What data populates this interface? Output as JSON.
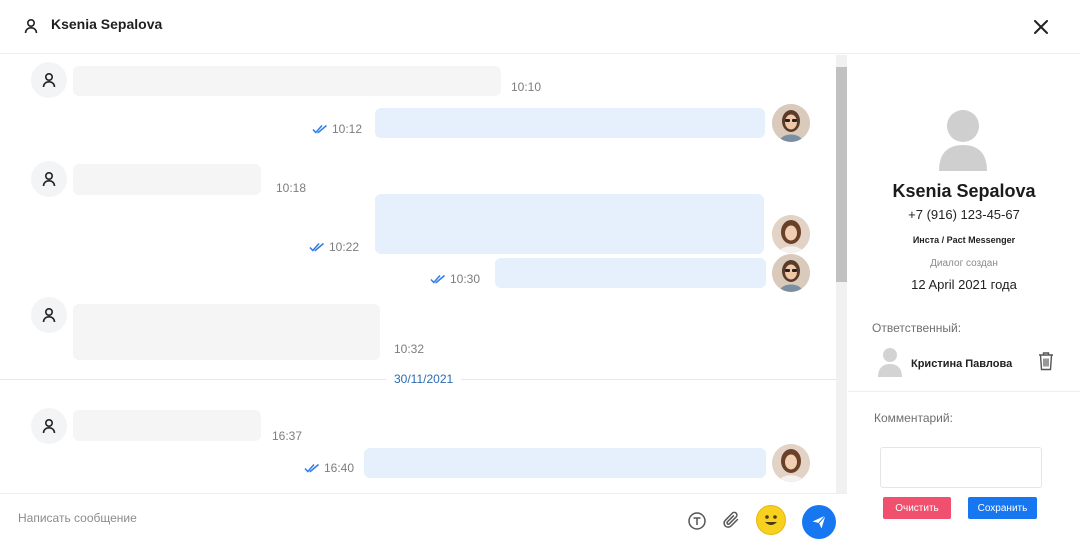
{
  "header": {
    "title": "Ksenia Sepalova"
  },
  "messages": [
    {
      "direction": "in",
      "time": "10:10"
    },
    {
      "direction": "out",
      "time": "10:12",
      "status": "read"
    },
    {
      "direction": "in",
      "time": "10:18"
    },
    {
      "direction": "out",
      "time": "10:22",
      "status": "read"
    },
    {
      "direction": "out",
      "time": "10:30",
      "status": "read"
    },
    {
      "direction": "in",
      "time": "10:32"
    },
    {
      "direction": "in",
      "time": "16:37"
    },
    {
      "direction": "out",
      "time": "16:40",
      "status": "read"
    }
  ],
  "date_separator": "30/11/2021",
  "composer": {
    "placeholder": "Написать сообщение"
  },
  "sidebar": {
    "name": "Ksenia Sepalova",
    "phone": "+7 (916) 123-45-67",
    "source": "Инста / Pact Messenger",
    "created_label": "Диалог создан",
    "created_date": "12 April 2021 года",
    "responsible_label": "Ответственный:",
    "responsible_name": "Кристина Павлова",
    "comment_label": "Комментарий:",
    "clear_label": "Очистить",
    "save_label": "Сохранить"
  },
  "colors": {
    "accent": "#1677f0",
    "danger": "#f0506e",
    "outgoing_bubble": "#e6effc",
    "incoming_bubble": "#f5f5f6",
    "date_separator": "#2b6cb0"
  },
  "icons": [
    "user-icon",
    "close-icon",
    "double-check-icon",
    "template-icon",
    "paperclip-icon",
    "emoji-icon",
    "send-icon",
    "trash-icon"
  ]
}
